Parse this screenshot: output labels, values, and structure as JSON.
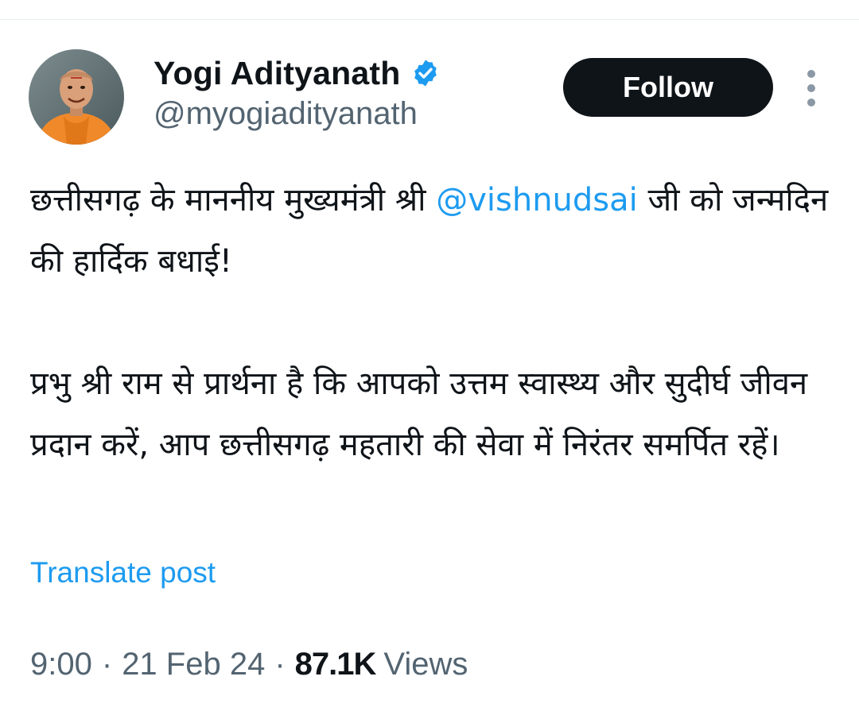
{
  "author": {
    "display_name": "Yogi Adityanath",
    "handle": "@myogiadityanath",
    "verified_icon": "verified-badge-icon",
    "avatar": "profile-photo"
  },
  "actions": {
    "follow_label": "Follow",
    "more_icon": "more-options-icon"
  },
  "tweet": {
    "paragraph1_text_before": "छत्तीसगढ़ के माननीय मुख्यमंत्री श्री ",
    "paragraph1_mention": "@vishnudsai",
    "paragraph1_text_after": " जी को जन्मदिन की हार्दिक बधाई!",
    "paragraph2": "प्रभु श्री राम से प्रार्थना है कि आपको उत्तम स्वास्थ्य और सुदीर्घ जीवन प्रदान करें, आप छत्तीसगढ़ महतारी की सेवा में निरंतर समर्पित रहें।"
  },
  "translate_label": "Translate post",
  "meta": {
    "time": "9:00",
    "separator": "·",
    "date": "21 Feb 24",
    "views_count": "87.1K",
    "views_label": "Views"
  },
  "colors": {
    "link": "#1d9bf0",
    "text": "#0f1419",
    "secondary": "#536471",
    "button_bg": "#0f1419",
    "saffron": "#f0892a"
  }
}
